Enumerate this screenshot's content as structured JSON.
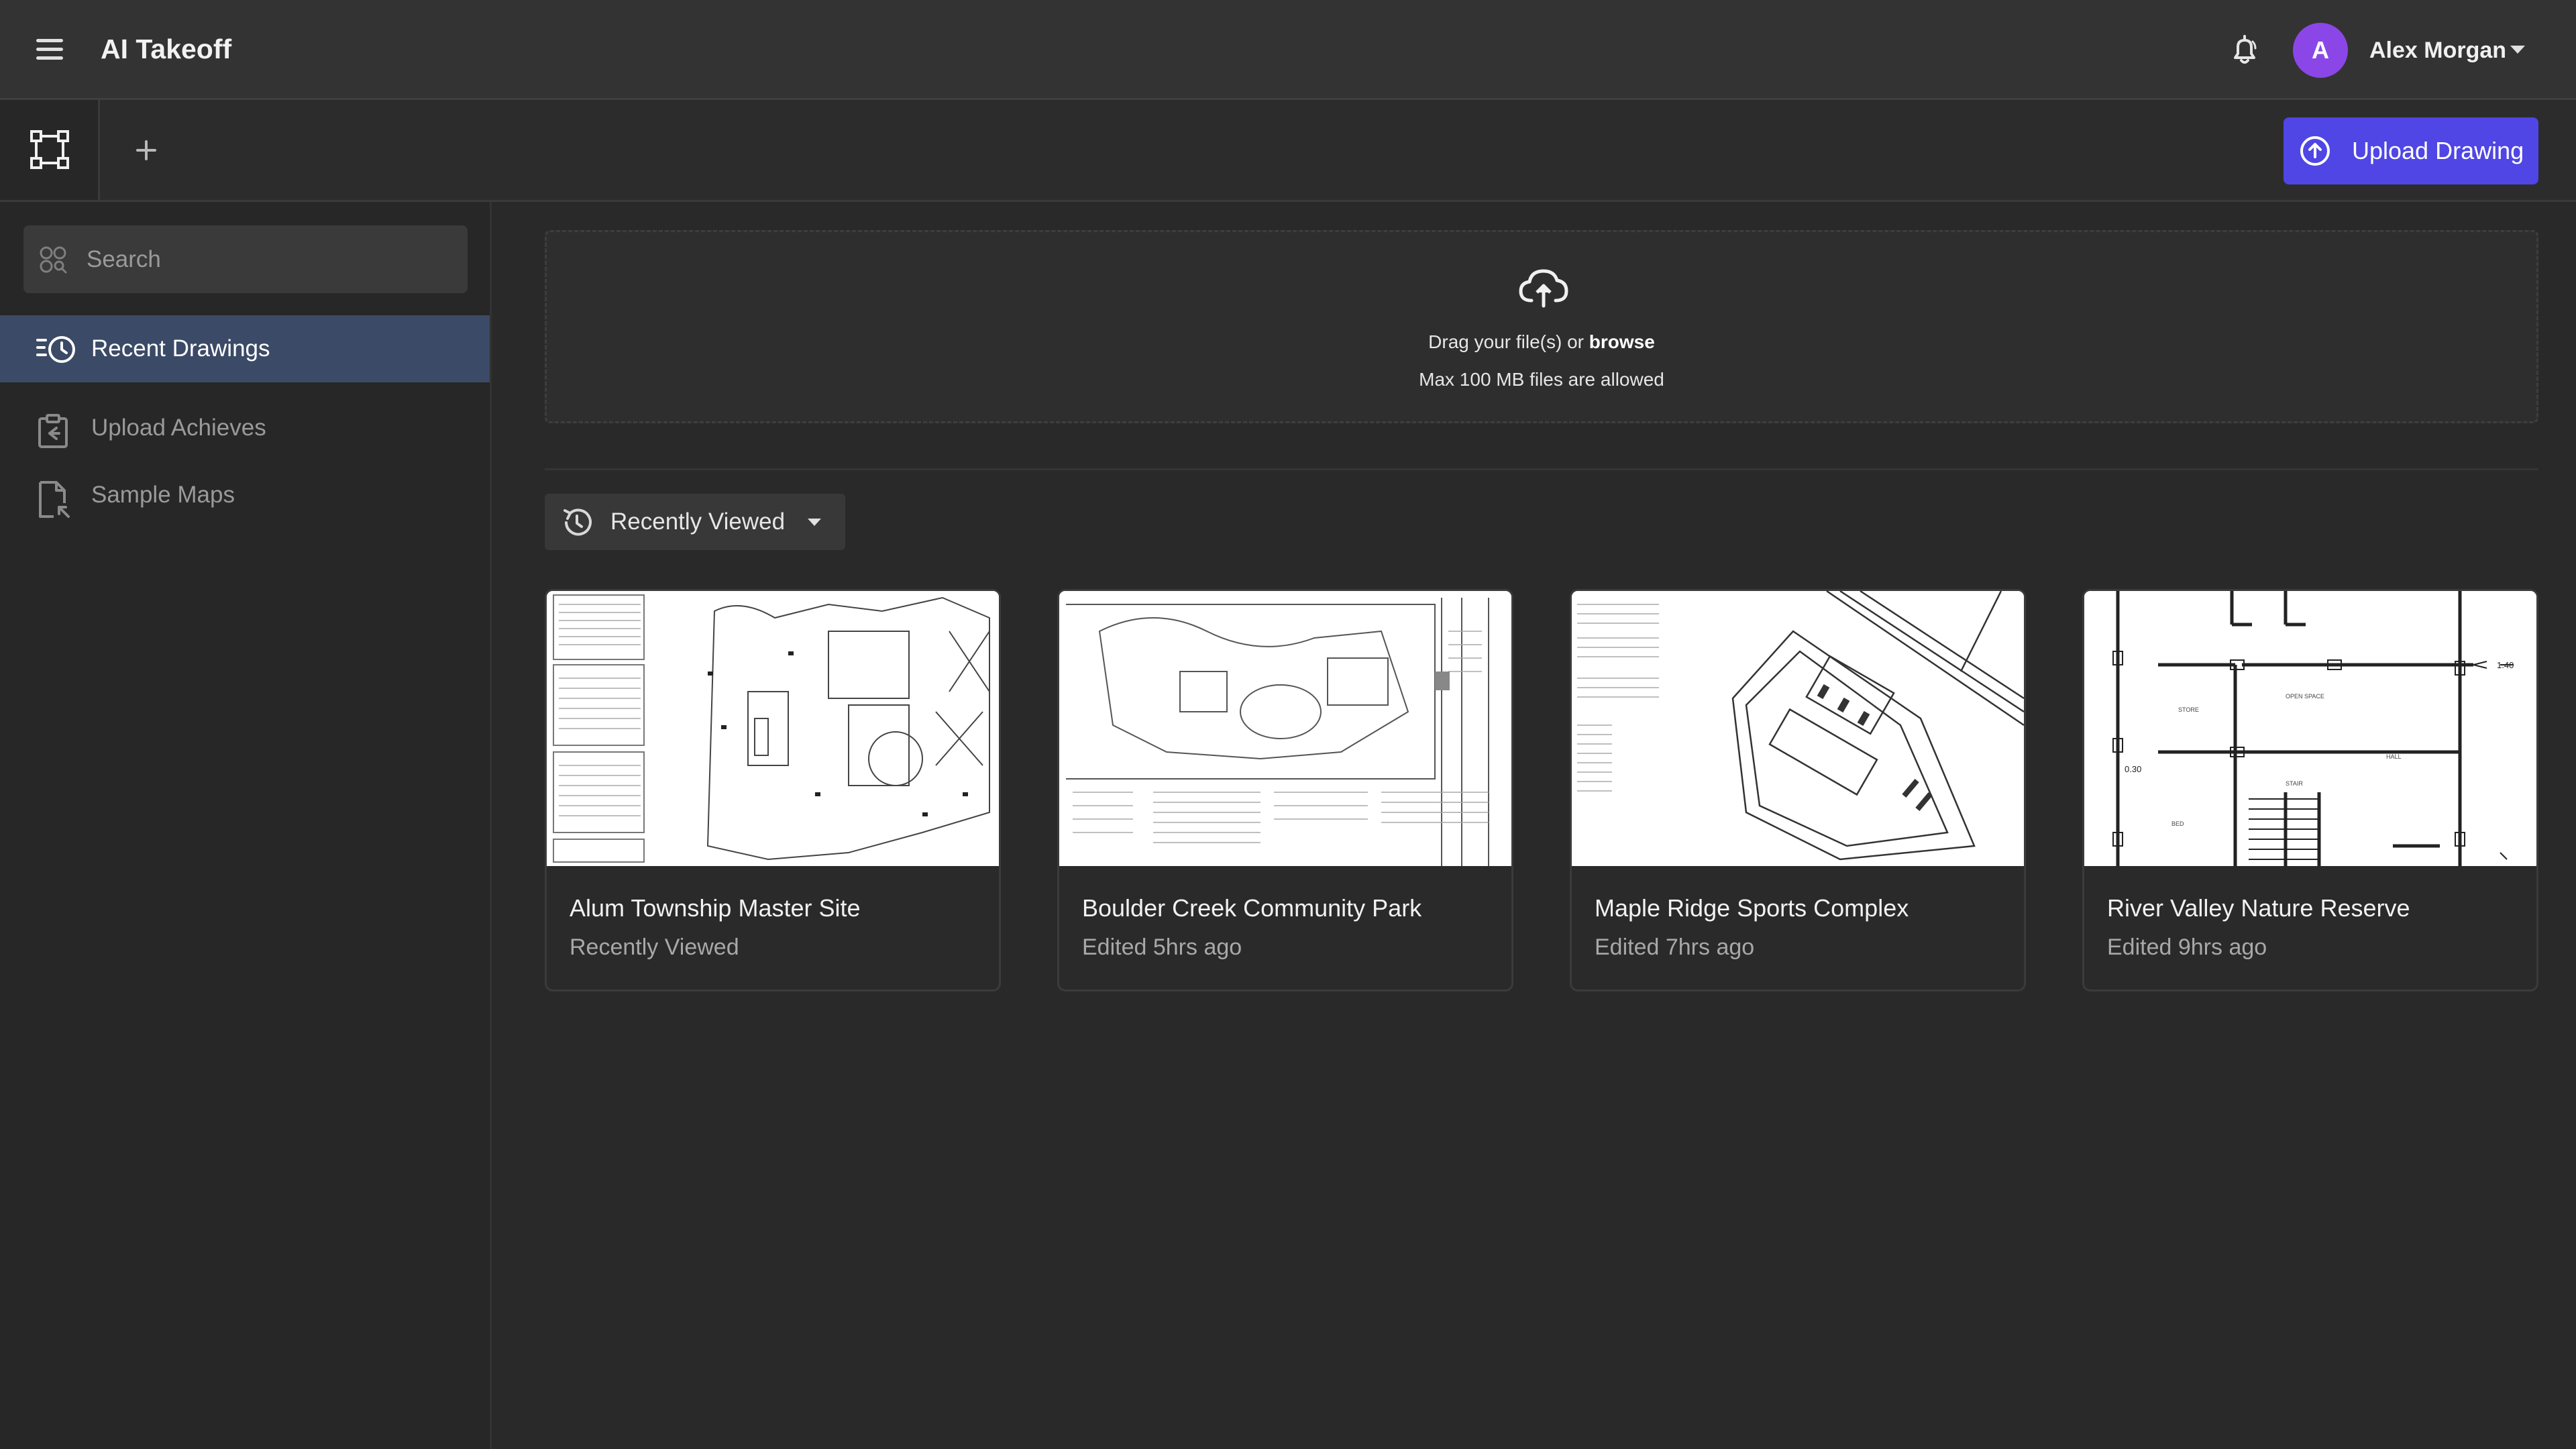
{
  "header": {
    "app_title": "AI Takeoff",
    "user": {
      "initial": "A",
      "name": "Alex Morgan"
    }
  },
  "toolbar": {
    "upload_label": "Upload Drawing"
  },
  "sidebar": {
    "search_placeholder": "Search",
    "items": [
      {
        "label": "Recent Drawings",
        "icon": "history-icon",
        "active": true
      },
      {
        "label": "Upload Achieves",
        "icon": "upload-archive-icon",
        "active": false
      },
      {
        "label": "Sample Maps",
        "icon": "document-icon",
        "active": false
      }
    ]
  },
  "dropzone": {
    "text": "Drag your file(s) or",
    "link": "browse",
    "sub": "Max 100 MB files are allowed"
  },
  "sort": {
    "label": "Recently Viewed"
  },
  "cards": [
    {
      "title": "Alum Township Master Site",
      "subtitle": "Recently Viewed"
    },
    {
      "title": "Boulder Creek Community Park",
      "subtitle": "Edited 5hrs ago"
    },
    {
      "title": "Maple Ridge Sports Complex",
      "subtitle": "Edited 7hrs ago"
    },
    {
      "title": "River Valley Nature Reserve",
      "subtitle": "Edited 9hrs ago"
    }
  ],
  "colors": {
    "accent": "#4f46e5",
    "avatar": "#8b46e8",
    "active_nav": "#3b4a66",
    "background": "#292929"
  }
}
